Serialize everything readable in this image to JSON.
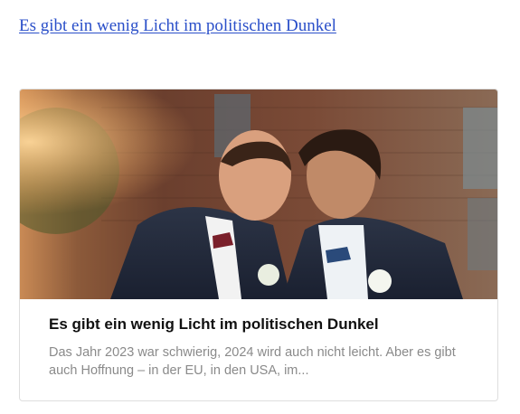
{
  "link": {
    "text": "Es gibt ein wenig Licht im politischen Dunkel"
  },
  "card": {
    "title": "Es gibt ein wenig Licht im politischen Dunkel",
    "excerpt": "Das Jahr 2023 war schwierig, 2024 wird auch nicht leicht. Aber es gibt auch Hoffnung – in der EU, in den USA, im..."
  },
  "colors": {
    "link": "#2a4fc9",
    "title": "#111111",
    "excerpt": "#8a8a8a",
    "card_border": "#dedede"
  }
}
